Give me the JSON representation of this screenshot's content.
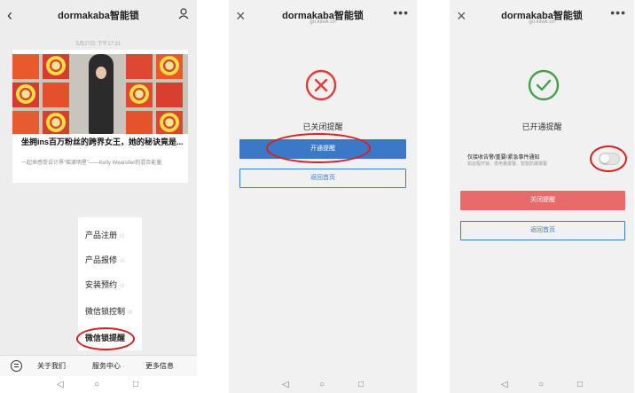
{
  "screen1": {
    "title": "dormakaba智能锁",
    "timestamp": "5月27日 下午17:31",
    "article": {
      "title": "坐拥ins百万粉丝的跨界女王，她的秘诀竟是...",
      "desc": "一起来感受设计界“摇滚明星”——Kelly Wearstler的混合能量"
    },
    "menu": [
      "产品注册",
      "产品报修",
      "安装预约",
      "微信锁控制",
      "微信锁提醒"
    ],
    "tabs": [
      "关于我们",
      "服务中心",
      "更多信息"
    ]
  },
  "screen2": {
    "title": "dormakaba智能锁",
    "domain": "go.kiiwk.cn",
    "status": "已关闭提醒",
    "primary_button": "开通提醒",
    "secondary_button": "返回首页",
    "status_color": "#e53935",
    "button_color": "#3b78c6"
  },
  "screen3": {
    "title": "dormakaba智能锁",
    "domain": "go.kiiwk.cn",
    "status": "已开通提醒",
    "option_title": "仅接收告警/重要/紧急事件通知",
    "option_desc": "如远程开锁、低电量报警、智能防撬报警",
    "primary_button": "关闭提醒",
    "secondary_button": "返回首页",
    "status_color": "#43a047",
    "button_color": "#e96a6a"
  },
  "nav": {
    "back": "◁",
    "home": "○",
    "recent": "□"
  }
}
